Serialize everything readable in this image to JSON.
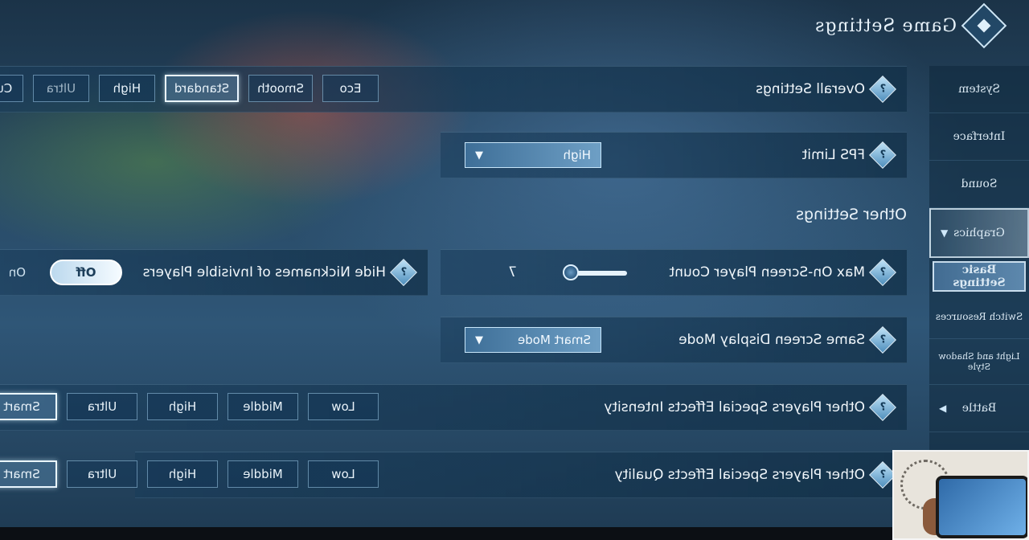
{
  "header": {
    "title": "Game Settings"
  },
  "sidebar": {
    "items": [
      {
        "label": "System"
      },
      {
        "label": "Interface"
      },
      {
        "label": "Sound"
      },
      {
        "label": "Graphics"
      },
      {
        "label": "Basic Settings"
      },
      {
        "label": "Switch Resources"
      },
      {
        "label": "Light and Shadow Style"
      },
      {
        "label": "Battle"
      }
    ]
  },
  "overall": {
    "label": "Overall Settings",
    "options": [
      "Eco",
      "Smooth",
      "Standard",
      "High",
      "Ultra",
      "Custo"
    ],
    "selected": "Standard"
  },
  "fps": {
    "label": "FPS Limit",
    "value": "High"
  },
  "other_title": "Other Settings",
  "max_players": {
    "label": "Max On-Screen Player Count",
    "value": "7"
  },
  "hide_nick": {
    "label": "Hide Nicknames of Invisible Players",
    "toggle": "Off",
    "other": "On"
  },
  "same_screen": {
    "label": "Same Screen Display Mode",
    "value": "Smart Mode"
  },
  "intensity": {
    "label": "Other Players Special Effects Intensity",
    "options": [
      "Low",
      "Middle",
      "High",
      "Ultra",
      "Smart"
    ],
    "selected": "Smart"
  },
  "quality": {
    "label": "Other Players Special Effects Quality",
    "options": [
      "Low",
      "Middle",
      "High",
      "Ultra",
      "Smart"
    ],
    "selected": "Smart"
  },
  "icons": {
    "help": "help-icon",
    "logo": "diamond-logo-icon",
    "dropdown": "triangle-down-icon",
    "chevron": "chevron-icon"
  }
}
